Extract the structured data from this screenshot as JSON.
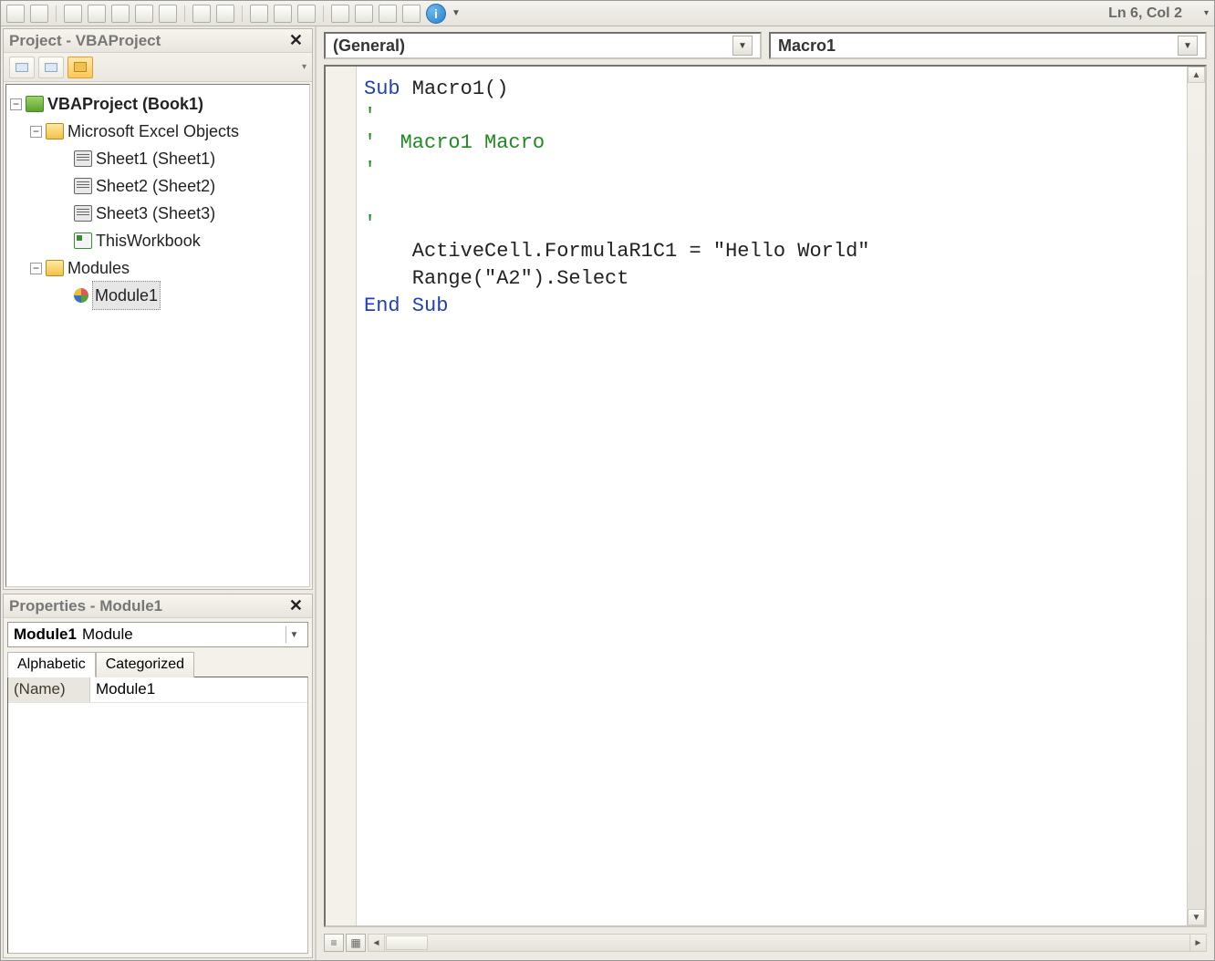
{
  "toolbar": {
    "status": "Ln 6, Col 2"
  },
  "project_pane": {
    "title": "Project - VBAProject",
    "root": "VBAProject (Book1)",
    "folder_objects": "Microsoft Excel Objects",
    "sheet1": "Sheet1 (Sheet1)",
    "sheet2": "Sheet2 (Sheet2)",
    "sheet3": "Sheet3 (Sheet3)",
    "workbook": "ThisWorkbook",
    "folder_modules": "Modules",
    "module1": "Module1"
  },
  "properties_pane": {
    "title": "Properties - Module1",
    "combo_bold": "Module1",
    "combo_type": "Module",
    "tab_alpha": "Alphabetic",
    "tab_cat": "Categorized",
    "row_name_label": "(Name)",
    "row_name_value": "Module1"
  },
  "code_pane": {
    "combo_left": "(General)",
    "combo_right": "Macro1",
    "lines": {
      "l1a": "Sub",
      "l1b": " Macro1()",
      "l2": "'",
      "l3": "'  Macro1 Macro",
      "l4": "'",
      "l5": "",
      "l6": "'",
      "l7": "    ActiveCell.FormulaR1C1 = \"Hello World\"",
      "l8": "    Range(\"A2\").Select",
      "l9a": "End",
      "l9b": " Sub"
    }
  }
}
